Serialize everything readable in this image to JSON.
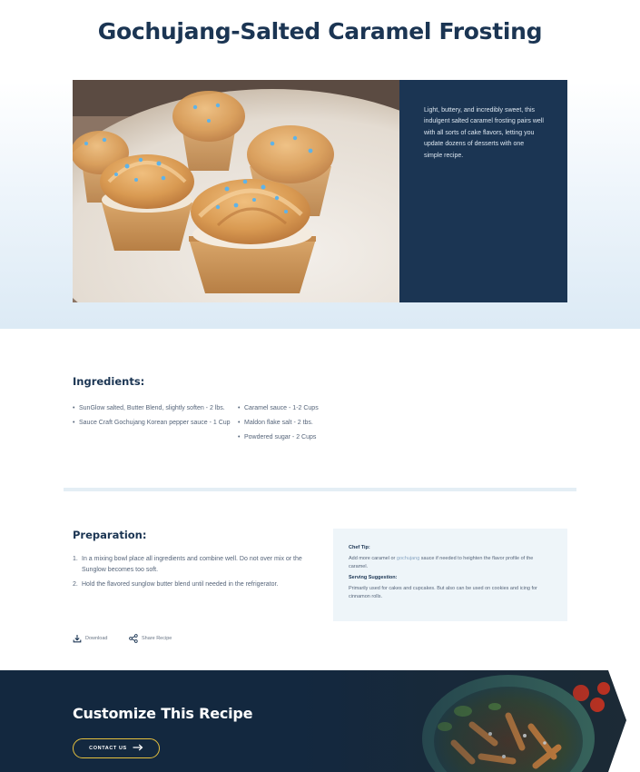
{
  "page": {
    "title": "Gochujang-Salted Caramel Frosting"
  },
  "hero": {
    "image_icon": "cupcake-photo",
    "description": "Light, buttery, and incredibly sweet, this indulgent salted caramel frosting pairs well with all sorts of cake flavors, letting you update dozens of desserts with one simple recipe."
  },
  "ingredients": {
    "title": "Ingredients:",
    "column_left": [
      "SunGlow salted, Butter Blend, slightly soften - 2 lbs.",
      "Sauce Craft Gochujang Korean pepper sauce - 1 Cup"
    ],
    "column_right": [
      "Caramel sauce - 1-2 Cups",
      "Maldon flake salt - 2 tbs.",
      "Powdered sugar - 2 Cups"
    ]
  },
  "preparation": {
    "title": "Preparation:",
    "steps": [
      {
        "num": "1.",
        "text": "In a mixing bowl place all ingredients and combine well. Do not over mix or the Sunglow becomes too soft."
      },
      {
        "num": "2.",
        "text": "Hold the flavored sunglow butter blend until needed in the refrigerator."
      }
    ]
  },
  "tips": {
    "chef_tip_heading": "Chef Tip:",
    "chef_tip_before": "Add more caramel or ",
    "chef_tip_link": "gochujang",
    "chef_tip_after": " sauce if needed to heighten the flavor profile of the caramel.",
    "serving_heading": "Serving Suggestion:",
    "serving_text": "Primarily used for cakes and cupcakes. But also can be used on cookies and icing for cinnamon rolls."
  },
  "actions": {
    "download_label": "Download",
    "download_icon": "download-icon",
    "share_label": "Share Recipe",
    "share_icon": "share-icon"
  },
  "cta": {
    "title": "Customize This Recipe",
    "button_label": "CONTACT US",
    "button_icon": "arrow-right-icon",
    "image_icon": "pasta-bowl-photo"
  },
  "colors": {
    "navy": "#1b3553",
    "dark_navy": "#13283f",
    "accent_yellow": "#e6c13e",
    "tip_background": "#eef5f9"
  }
}
